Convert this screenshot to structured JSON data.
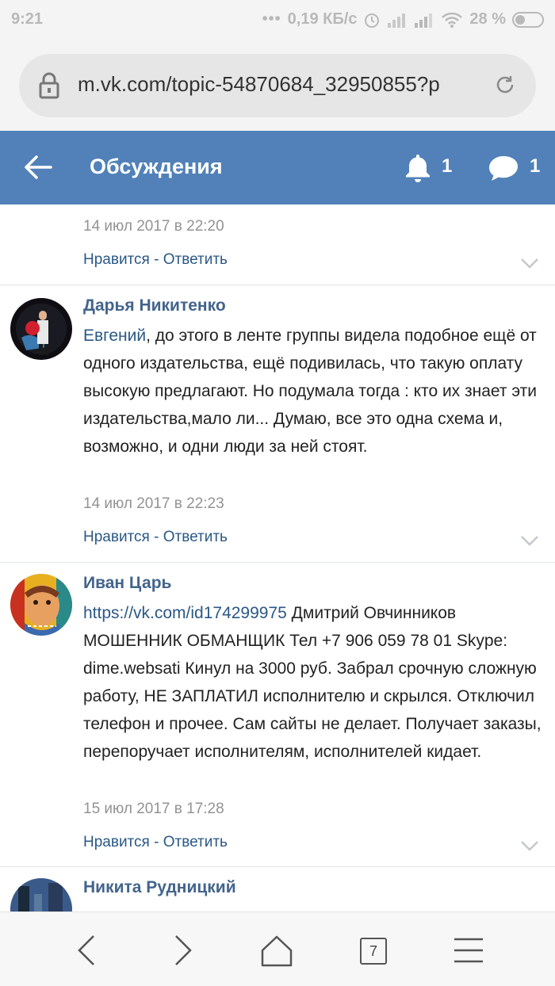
{
  "status_bar": {
    "time": "9:21",
    "dots": "•••",
    "network_speed": "0,19 КБ/с",
    "battery": "28 %"
  },
  "browser": {
    "url": "m.vk.com/topic-54870684_32950855?p",
    "tabs_count": "7"
  },
  "header": {
    "title": "Обсуждения",
    "notifications_count": "1",
    "messages_count": "1"
  },
  "comments": [
    {
      "author": "",
      "date": "14 июл 2017 в 22:20",
      "like_label": "Нравится",
      "sep": " - ",
      "reply_label": "Ответить"
    },
    {
      "author": "Дарья Никитенко",
      "mention": "Евгений",
      "text": ", до этого в ленте группы видела подобное ещё от одного издательства, ещё подивилась, что такую оплату высокую предлагают. Но подумала тогда : кто их знает эти издательства,мало ли... Думаю, все это одна схема и, возможно, и одни люди за ней стоят.",
      "date": "14 июл 2017 в 22:23",
      "like_label": "Нравится",
      "sep": " - ",
      "reply_label": "Ответить"
    },
    {
      "author": "Иван Царь",
      "mention": "https://vk.com/id174299975",
      "text": " Дмитрий Овчинников МОШЕННИК ОБМАНЩИК Тел +7 906 059 78 01 Skype: dime.websati Кинул на 3000 руб. Забрал срочную сложную работу, НЕ ЗАПЛАТИЛ исполнителю и скрылся. Отключил телефон и прочее. Сам сайты не делает. Получает заказы, перепоручает исполнителям, исполнителей кидает.",
      "date": "15 июл 2017 в 17:28",
      "like_label": "Нравится",
      "sep": " - ",
      "reply_label": "Ответить"
    },
    {
      "author": "Никита Рудницкий"
    }
  ],
  "icons": {
    "back": "arrow-left-icon",
    "bell": "bell-icon",
    "messages": "chat-bubble-icon",
    "lock": "lock-icon",
    "reload": "reload-icon",
    "chevron": "chevron-down-icon"
  },
  "colors": {
    "header_bg": "#5181b8",
    "link": "#2a5885",
    "author": "#42648b",
    "date": "#939393"
  }
}
